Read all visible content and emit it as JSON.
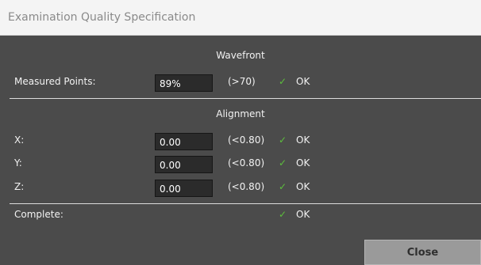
{
  "window": {
    "title": "Examination Quality Specification"
  },
  "wavefront": {
    "heading": "Wavefront",
    "label": "Measured Points:",
    "value": "89%",
    "requirement": "(>70)",
    "status": "OK"
  },
  "alignment": {
    "heading": "Alignment",
    "rows": [
      {
        "label": "X:",
        "value": "0.00",
        "requirement": "(<0.80)",
        "status": "OK"
      },
      {
        "label": "Y:",
        "value": "0.00",
        "requirement": "(<0.80)",
        "status": "OK"
      },
      {
        "label": "Z:",
        "value": "0.00",
        "requirement": "(<0.80)",
        "status": "OK"
      }
    ]
  },
  "complete": {
    "label": "Complete:",
    "status": "OK"
  },
  "buttons": {
    "close_label": "Close"
  },
  "icons": {
    "status": "checkmark-icon"
  },
  "colors": {
    "check": "#5cbf3c",
    "background": "#4b4b4b",
    "field": "#2b2b2b"
  }
}
